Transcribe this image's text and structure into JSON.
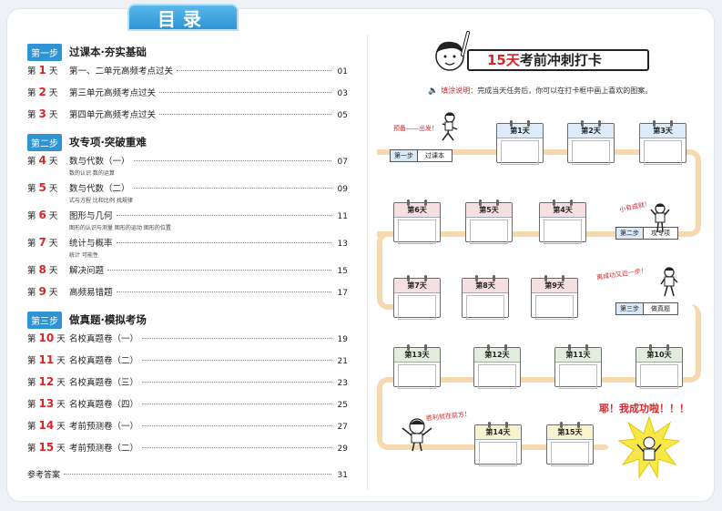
{
  "header": {
    "title": "目录"
  },
  "toc": {
    "sections": [
      {
        "step": "第一步",
        "title": "过课本·夯实基础",
        "days": [
          {
            "pre": "第",
            "num": "1",
            "post": "天",
            "title": "第一、二单元高频考点过关",
            "page": "01",
            "topics": ""
          },
          {
            "pre": "第",
            "num": "2",
            "post": "天",
            "title": "第三单元高频考点过关",
            "page": "03",
            "topics": ""
          },
          {
            "pre": "第",
            "num": "3",
            "post": "天",
            "title": "第四单元高频考点过关",
            "page": "05",
            "topics": ""
          }
        ]
      },
      {
        "step": "第二步",
        "title": "攻专项·突破重难",
        "days": [
          {
            "pre": "第",
            "num": "4",
            "post": "天",
            "title": "数与代数（一）",
            "page": "07",
            "topics": "数的认识 数的运算"
          },
          {
            "pre": "第",
            "num": "5",
            "post": "天",
            "title": "数与代数（二）",
            "page": "09",
            "topics": "式与方程 比和比例 找规律"
          },
          {
            "pre": "第",
            "num": "6",
            "post": "天",
            "title": "图形与几何",
            "page": "11",
            "topics": "图形的认识与测量 图形的运动 图形的位置"
          },
          {
            "pre": "第",
            "num": "7",
            "post": "天",
            "title": "统计与概率",
            "page": "13",
            "topics": "统计 可能性"
          },
          {
            "pre": "第",
            "num": "8",
            "post": "天",
            "title": "解决问题",
            "page": "15",
            "topics": ""
          },
          {
            "pre": "第",
            "num": "9",
            "post": "天",
            "title": "高频易错题",
            "page": "17",
            "topics": ""
          }
        ]
      },
      {
        "step": "第三步",
        "title": "做真题·模拟考场",
        "days": [
          {
            "pre": "第",
            "num": "10",
            "post": "天",
            "title": "名校真题卷（一）",
            "page": "19",
            "topics": ""
          },
          {
            "pre": "第",
            "num": "11",
            "post": "天",
            "title": "名校真题卷（二）",
            "page": "21",
            "topics": ""
          },
          {
            "pre": "第",
            "num": "12",
            "post": "天",
            "title": "名校真题卷（三）",
            "page": "23",
            "topics": ""
          },
          {
            "pre": "第",
            "num": "13",
            "post": "天",
            "title": "名校真题卷（四）",
            "page": "25",
            "topics": ""
          },
          {
            "pre": "第",
            "num": "14",
            "post": "天",
            "title": "考前预测卷（一）",
            "page": "27",
            "topics": ""
          },
          {
            "pre": "第",
            "num": "15",
            "post": "天",
            "title": "考前预测卷（二）",
            "page": "29",
            "topics": ""
          }
        ]
      }
    ],
    "answers": {
      "title": "参考答案",
      "page": "31"
    }
  },
  "checkin": {
    "banner_red": "15天",
    "banner_rest": "考前冲刺打卡",
    "instruction_label": "填涂说明：",
    "instruction_text": "完成当天任务后，你可以在打卡框中画上喜欢的图案。",
    "notes": {
      "start": "预备——出发！",
      "mid1": "小有成就！",
      "mid2": "离成功又近一步！",
      "almost": "胜利就在前方！",
      "success": "耶！我成功啦！！！"
    },
    "steps": [
      {
        "a": "第一步",
        "b": "过课本"
      },
      {
        "a": "第二步",
        "b": "攻专项"
      },
      {
        "a": "第三步",
        "b": "做真题"
      }
    ],
    "calendars": [
      "第1天",
      "第2天",
      "第3天",
      "第6天",
      "第5天",
      "第4天",
      "第7天",
      "第8天",
      "第9天",
      "第13天",
      "第12天",
      "第11天",
      "第10天",
      "第14天",
      "第15天"
    ],
    "colors": {
      "accent": "#2e94d4",
      "red": "#d8262a",
      "path": "#f7d9b0"
    }
  }
}
